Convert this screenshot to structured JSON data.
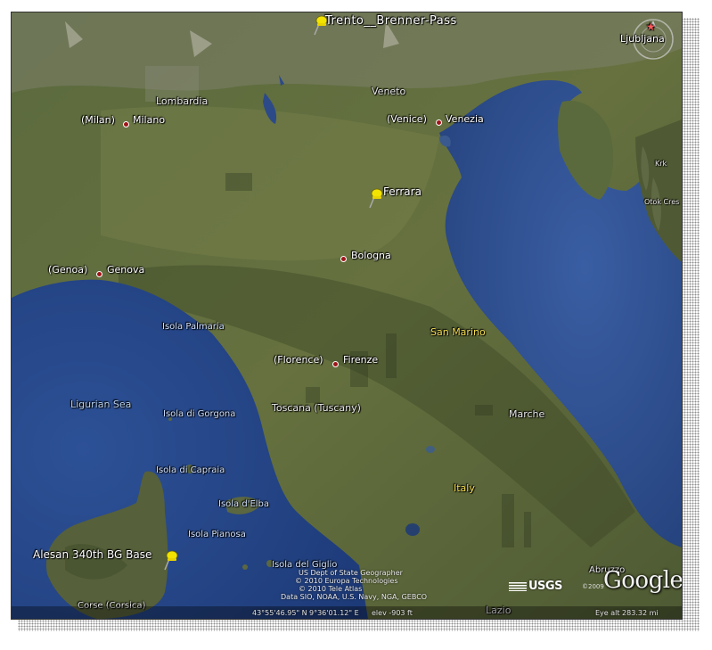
{
  "map": {
    "pins": {
      "brenner": "Trento__Brenner-Pass",
      "ferrara": "Ferrara",
      "alesan": "Alesan  340th BG Base"
    },
    "cities": {
      "ljubljana": "Ljubljana",
      "milano_en": "(Milan)",
      "milano": "Milano",
      "venezia_en": "(Venice)",
      "venezia": "Venezia",
      "genova_en": "(Genoa)",
      "genova": "Genova",
      "bologna": "Bologna",
      "firenze_en": "(Florence)",
      "firenze": "Firenze"
    },
    "regions": {
      "lombardia": "Lombardia",
      "veneto": "Veneto",
      "toscana": "Toscana (Tuscany)",
      "marche": "Marche",
      "abruzzo": "Abruzzo",
      "lazio": "Lazio",
      "corse": "Corse (Corsica)",
      "krk": "Krk",
      "otok_cres": "Otok Cres"
    },
    "countries": {
      "san_marino": "San Marino",
      "italy": "Italy"
    },
    "sea": {
      "ligurian": "Ligurian Sea"
    },
    "islands": {
      "palmaria": "Isola Palmaria",
      "gorgona": "Isola di Gorgona",
      "capraia": "Isola di Capraia",
      "elba": "Isola d'Elba",
      "pianosa": "Isola Pianosa",
      "giglio": "Isola del Giglio"
    },
    "credits": [
      "US Dept of State Geographer",
      "© 2010 Europa Technologies",
      "© 2010 Tele Atlas",
      "Data SIO, NOAA, U.S. Navy, NGA, GEBCO"
    ],
    "logos": {
      "usgs": "USGS",
      "google": "Google",
      "copyright": "©2009"
    },
    "status": {
      "lat": "43°55'46.95\" N",
      "lon": "9°36'01.12\" E",
      "elev": "elev  -903 ft",
      "eye_alt": "Eye alt  283.32 mi"
    },
    "colors": {
      "sea": "#2f4e8c",
      "land": "#56633a",
      "pin": "#f2e300",
      "city_dot": "#a0151a"
    }
  }
}
